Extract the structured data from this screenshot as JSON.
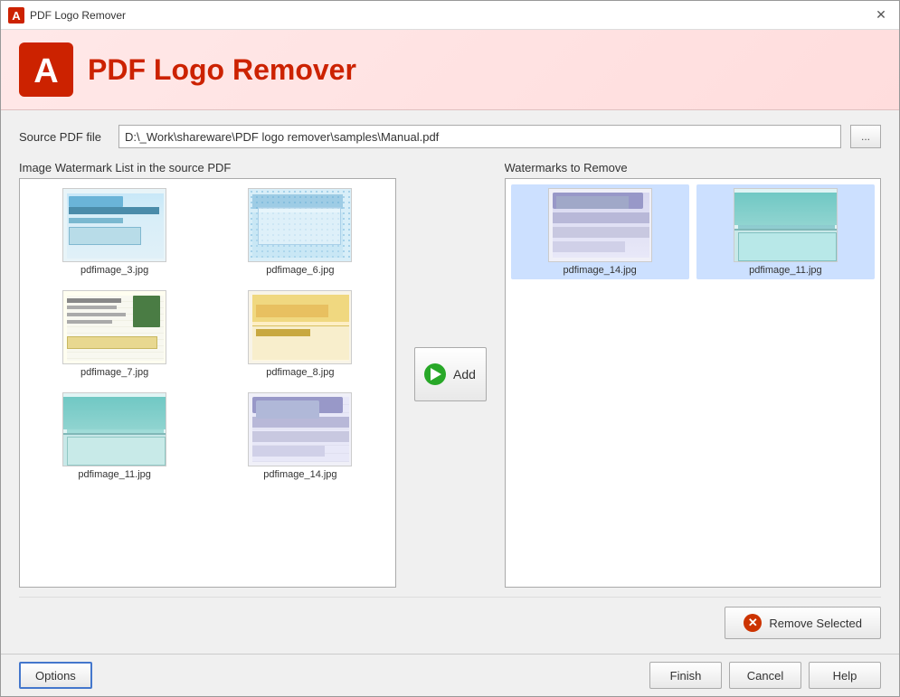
{
  "window": {
    "title": "PDF Logo Remover",
    "close_label": "✕"
  },
  "header": {
    "title": "PDF Logo Remover",
    "logo_alt": "PDF Logo Remover Logo"
  },
  "source": {
    "label": "Source PDF file",
    "path": "D:\\_Work\\shareware\\PDF logo remover\\samples\\Manual.pdf",
    "browse_label": "..."
  },
  "left_panel": {
    "label": "Image Watermark List in the source PDF",
    "items": [
      {
        "filename": "pdfimage_3.jpg",
        "thumb_class": "thumb-img3"
      },
      {
        "filename": "pdfimage_6.jpg",
        "thumb_class": "thumb-img6"
      },
      {
        "filename": "pdfimage_7.jpg",
        "thumb_class": "thumb-img7"
      },
      {
        "filename": "pdfimage_8.jpg",
        "thumb_class": "thumb-img8"
      },
      {
        "filename": "pdfimage_11.jpg",
        "thumb_class": "thumb-img11"
      },
      {
        "filename": "pdfimage_14.jpg",
        "thumb_class": "thumb-img14"
      }
    ]
  },
  "add_button": {
    "label": "Add"
  },
  "right_panel": {
    "label": "Watermarks to Remove",
    "items": [
      {
        "filename": "pdfimage_14.jpg",
        "thumb_class": "thumb-img14r"
      },
      {
        "filename": "pdfimage_11.jpg",
        "thumb_class": "thumb-img11r"
      }
    ]
  },
  "remove_button": {
    "label": "Remove Selected"
  },
  "footer": {
    "options_label": "Options",
    "finish_label": "Finish",
    "cancel_label": "Cancel",
    "help_label": "Help"
  }
}
